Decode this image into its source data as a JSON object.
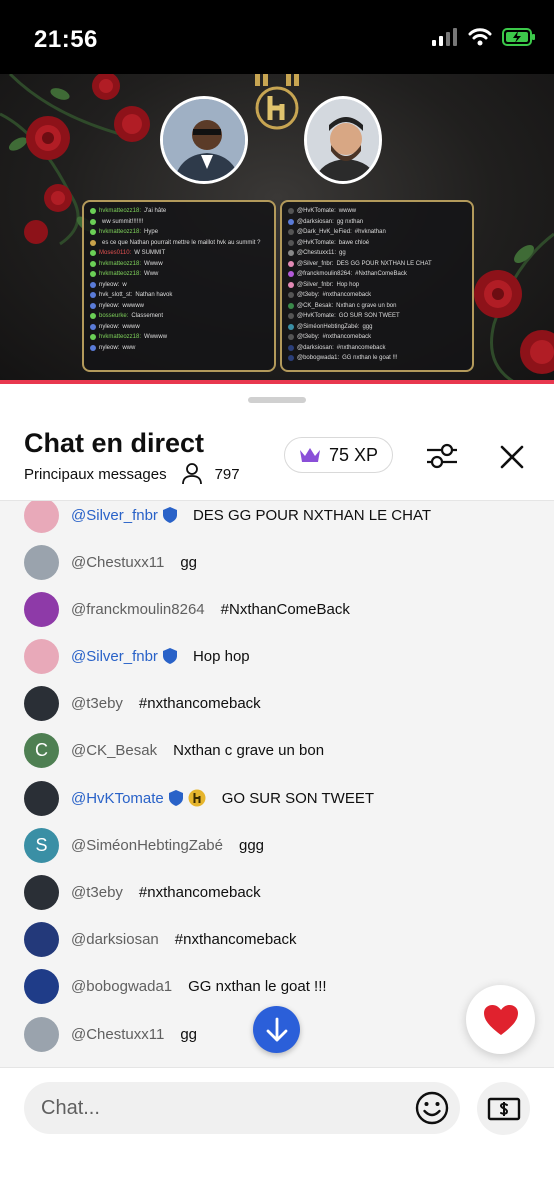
{
  "status_bar": {
    "time": "21:56"
  },
  "stream": {
    "left_panel": [
      {
        "user": "hvkmatteozz18:",
        "text": "J'ai hâte"
      },
      {
        "user": "",
        "text": "ww summit!!!!!!!"
      },
      {
        "user": "hvkmatteozz18:",
        "text": "Hype"
      },
      {
        "user": "",
        "text": "es ce que Nathan pourrait mettre le maillot hvk au summit ?"
      },
      {
        "user": "Moses0110:",
        "text": "W SUMMIT"
      },
      {
        "user": "hvkmatteozz18:",
        "text": "Wwww"
      },
      {
        "user": "hvkmatteozz18:",
        "text": "Www"
      },
      {
        "user": "nyleow:",
        "text": "w"
      },
      {
        "user": "hvk_slott_st:",
        "text": "Nathan havok"
      },
      {
        "user": "nyleow:",
        "text": "wwwww"
      },
      {
        "user": "bosseurke:",
        "text": "Classement"
      },
      {
        "user": "nyleow:",
        "text": "wwww"
      },
      {
        "user": "hvkmatteozz18:",
        "text": "Wwwww"
      },
      {
        "user": "nyleow:",
        "text": "www"
      }
    ],
    "right_panel": [
      {
        "user": "@HvKTomate:",
        "text": "wwww"
      },
      {
        "user": "@darksiosan:",
        "text": "gg nxthan"
      },
      {
        "user": "@Dark_HvK_leFied:",
        "text": "#hvknathan"
      },
      {
        "user": "@HvKTomate:",
        "text": "bawe chloé"
      },
      {
        "user": "@Chestuxx11:",
        "text": "gg"
      },
      {
        "user": "@Silver_fnbr:",
        "text": "DES GG POUR NXTHAN LE CHAT"
      },
      {
        "user": "@franckmoulin8264:",
        "text": "#NxthanComeBack"
      },
      {
        "user": "@Silver_fnbr:",
        "text": "Hop hop"
      },
      {
        "user": "@t3eby:",
        "text": "#nxthancomeback"
      },
      {
        "user": "@CK_Besak:",
        "text": "Nxthan c grave un bon"
      },
      {
        "user": "@HvKTomate:",
        "text": "GO SUR SON TWEET"
      },
      {
        "user": "@SiméonHebtingZabé:",
        "text": "ggg"
      },
      {
        "user": "@t3eby:",
        "text": "#nxthancomeback"
      },
      {
        "user": "@darksiosan:",
        "text": "#nxthancomeback"
      },
      {
        "user": "@bobogwada1:",
        "text": "GG nxthan le goat !!!"
      }
    ]
  },
  "header": {
    "title": "Chat en direct",
    "mode": "Principaux messages",
    "viewers": "797",
    "xp": "75 XP"
  },
  "messages": [
    {
      "user": "@Silver_fnbr",
      "text": "DES GG POUR NXTHAN LE CHAT",
      "mod": true,
      "avatar": "pink",
      "letter": ""
    },
    {
      "user": "@Chestuxx11",
      "text": "gg",
      "mod": false,
      "avatar": "gray",
      "letter": ""
    },
    {
      "user": "@franckmoulin8264",
      "text": "#NxthanComeBack",
      "mod": false,
      "avatar": "purple",
      "letter": ""
    },
    {
      "user": "@Silver_fnbr",
      "text": "Hop hop",
      "mod": true,
      "avatar": "pink",
      "letter": ""
    },
    {
      "user": "@t3eby",
      "text": "#nxthancomeback",
      "mod": false,
      "avatar": "dark",
      "letter": ""
    },
    {
      "user": "@CK_Besak",
      "text": "Nxthan c grave un bon",
      "mod": false,
      "avatar": "green",
      "letter": "C"
    },
    {
      "user": "@HvKTomate",
      "text": "GO SUR SON TWEET",
      "mod": true,
      "avatar": "dark",
      "letter": "",
      "member": true
    },
    {
      "user": "@SiméonHebtingZabé",
      "text": "ggg",
      "mod": false,
      "avatar": "teal",
      "letter": "S"
    },
    {
      "user": "@t3eby",
      "text": "#nxthancomeback",
      "mod": false,
      "avatar": "dark",
      "letter": ""
    },
    {
      "user": "@darksiosan",
      "text": "#nxthancomeback",
      "mod": false,
      "avatar": "navy",
      "letter": ""
    },
    {
      "user": "@bobogwada1",
      "text": "GG nxthan le goat !!!",
      "mod": false,
      "avatar": "france",
      "letter": ""
    },
    {
      "user": "@Chestuxx11",
      "text": "gg",
      "mod": false,
      "avatar": "gray",
      "letter": ""
    }
  ],
  "composer": {
    "placeholder": "Chat..."
  },
  "colors": {
    "accent_blue": "#2b5fd9",
    "moderator_blue": "#2962c8",
    "progress_red": "#e8384f",
    "xp_crown": "#8a4fd8"
  }
}
